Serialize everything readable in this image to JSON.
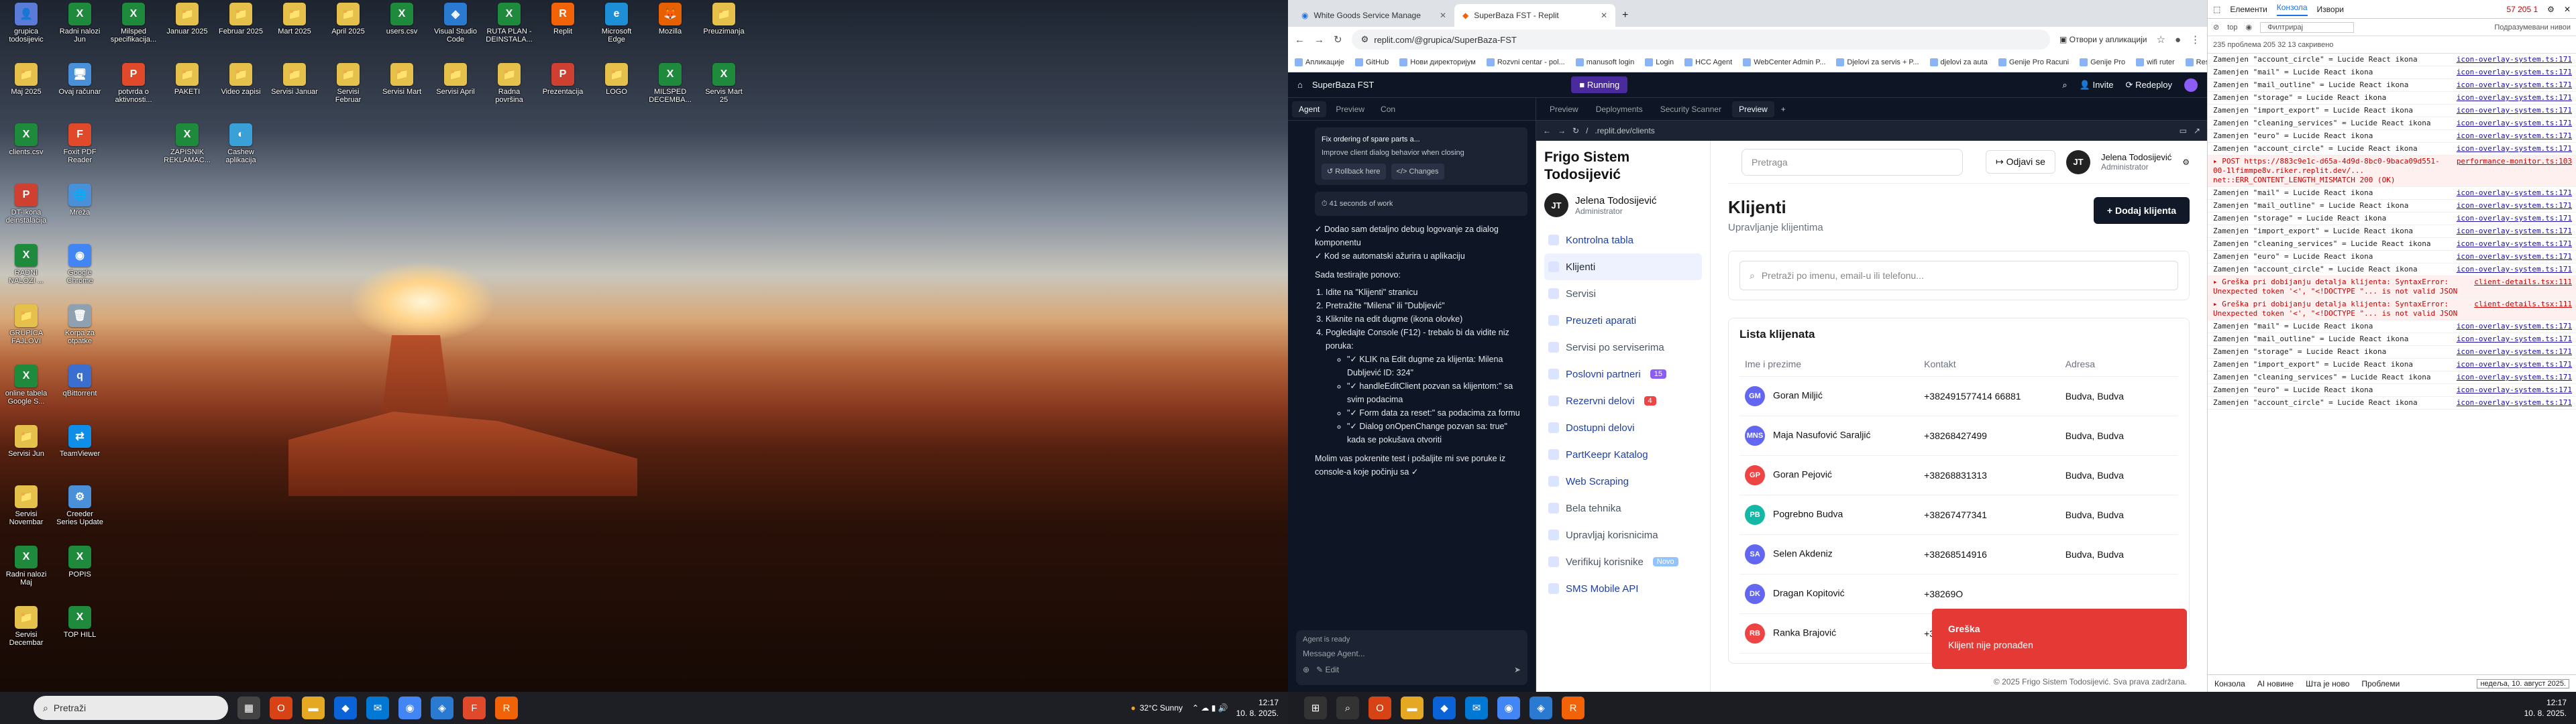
{
  "desktop": {
    "icons": [
      {
        "label": "grupica todosijevic",
        "color": "#5a7bd8",
        "glyph": "👤"
      },
      {
        "label": "Maj 2025",
        "color": "#e5c04a",
        "glyph": "📁"
      },
      {
        "label": "clients.csv",
        "color": "#1e8a3c",
        "glyph": "X"
      },
      {
        "label": "DT-Ikona deinstalacija",
        "color": "#d04030",
        "glyph": "P"
      },
      {
        "label": "RADNI NALOZI ...",
        "color": "#1e8a3c",
        "glyph": "X"
      },
      {
        "label": "GRUPICA FAJLOVI",
        "color": "#e5c04a",
        "glyph": "📁"
      },
      {
        "label": "online tabela Google S...",
        "color": "#1e8a3c",
        "glyph": "X"
      },
      {
        "label": "Servisi Jun",
        "color": "#e5c04a",
        "glyph": "📁"
      },
      {
        "label": "Servisi Novembar",
        "color": "#e5c04a",
        "glyph": "📁"
      },
      {
        "label": "Radni nalozi Maj",
        "color": "#1e8a3c",
        "glyph": "X"
      },
      {
        "label": "Servisi Decembar",
        "color": "#e5c04a",
        "glyph": "📁"
      },
      {
        "label": "Radni nalozi Jun",
        "color": "#1e8a3c",
        "glyph": "X"
      },
      {
        "label": "Ovaj računar",
        "color": "#4a90d9",
        "glyph": "🖥"
      },
      {
        "label": "Foxit PDF Reader",
        "color": "#e04a2a",
        "glyph": "F"
      },
      {
        "label": "Mreža",
        "color": "#4a90d9",
        "glyph": "🌐"
      },
      {
        "label": "Google Chrome",
        "color": "#4285f4",
        "glyph": "◉"
      },
      {
        "label": "Korpa za otpatke",
        "color": "#8fa0b0",
        "glyph": "🗑"
      },
      {
        "label": "qBittorrent",
        "color": "#3a6fd0",
        "glyph": "q"
      },
      {
        "label": "TeamViewer",
        "color": "#0e8ee9",
        "glyph": "⇄"
      },
      {
        "label": "Creeder Series Update",
        "color": "#4a90d9",
        "glyph": "⚙"
      },
      {
        "label": "POPIS",
        "color": "#1e8a3c",
        "glyph": "X"
      },
      {
        "label": "TOP HILL",
        "color": "#1e8a3c",
        "glyph": "X"
      },
      {
        "label": "Milsped specifikacija...",
        "color": "#1e8a3c",
        "glyph": "X"
      },
      {
        "label": "potvrda o aktivnosti...",
        "color": "#e04a2a",
        "glyph": "P"
      },
      {
        "label": "Januar 2025",
        "color": "#e5c04a",
        "glyph": "📁"
      },
      {
        "label": "Februar 2025",
        "color": "#e5c04a",
        "glyph": "📁"
      },
      {
        "label": "Mart 2025",
        "color": "#e5c04a",
        "glyph": "📁"
      },
      {
        "label": "April 2025",
        "color": "#e5c04a",
        "glyph": "📁"
      },
      {
        "label": "users.csv",
        "color": "#1e8a3c",
        "glyph": "X"
      },
      {
        "label": "Visual Studio Code",
        "color": "#2a7ad2",
        "glyph": "◈"
      },
      {
        "label": "RUTA PLAN - DEINSTALA...",
        "color": "#1e8a3c",
        "glyph": "X"
      },
      {
        "label": "Replit",
        "color": "#f26207",
        "glyph": "R"
      },
      {
        "label": "Microsoft Edge",
        "color": "#1d8fd6",
        "glyph": "e"
      },
      {
        "label": "Mozilla",
        "color": "#e66000",
        "glyph": "🦊"
      },
      {
        "label": "Preuzimanja",
        "color": "#e5c04a",
        "glyph": "📁"
      },
      {
        "label": "PAKETI",
        "color": "#e5c04a",
        "glyph": "📁"
      },
      {
        "label": "Video zapisi",
        "color": "#e5c04a",
        "glyph": "📁"
      },
      {
        "label": "Servisi Januar",
        "color": "#e5c04a",
        "glyph": "📁"
      },
      {
        "label": "Servisi Februar",
        "color": "#e5c04a",
        "glyph": "📁"
      },
      {
        "label": "Servisi Mart",
        "color": "#e5c04a",
        "glyph": "📁"
      },
      {
        "label": "Servisi April",
        "color": "#e5c04a",
        "glyph": "📁"
      },
      {
        "label": "Radna površina",
        "color": "#e5c04a",
        "glyph": "📁"
      },
      {
        "label": "Prezentacija",
        "color": "#d04030",
        "glyph": "P"
      },
      {
        "label": "LOGO",
        "color": "#e5c04a",
        "glyph": "📁"
      },
      {
        "label": "MILSPED DECEMBA...",
        "color": "#1e8a3c",
        "glyph": "X"
      },
      {
        "label": "Servis Mart 25",
        "color": "#1e8a3c",
        "glyph": "X"
      },
      {
        "label": "ZAPISNIK REKLAMAC...",
        "color": "#1e8a3c",
        "glyph": "X"
      },
      {
        "label": "Cashew aplikacija",
        "color": "#3aa0d8",
        "glyph": "◐"
      }
    ]
  },
  "taskbar_left": {
    "search_placeholder": "Pretraži",
    "weather": "32°C  Sunny",
    "time": "12:17",
    "date": "10. 8. 2025."
  },
  "browser": {
    "tabs": [
      {
        "label": "White Goods Service Manage"
      },
      {
        "label": "SuperBaza FST - Replit"
      }
    ],
    "url": "replit.com/@grupica/SuperBaza-FST",
    "open_in_app": "Отвори у апликацији",
    "bookmarks": [
      "Апликације",
      "GitHub",
      "Нови директоријум",
      "Rozvni centar - pol...",
      "manusoft login",
      "Login",
      "HCC Agent",
      "WebCenter Admin P...",
      "Djelovi za servis + P...",
      "djelovi za auta",
      "Genije Pro Racuni",
      "Genije Pro",
      "wifi ruter",
      "Resistor Calculator",
      "Сви обележивачи"
    ]
  },
  "replit": {
    "project": "SuperBaza FST",
    "run_label": "Running",
    "invite": "Invite",
    "redeploy": "Redeploy",
    "left_tabs": [
      "Agent",
      "Preview",
      "Con"
    ],
    "main_tabs": [
      "Preview",
      "Deployments",
      "Security Scanner",
      "Preview"
    ],
    "checkpoint": "Fix ordering of spare parts a...",
    "checkpoint_sub": "Improve client dialog behavior when closing",
    "rollback": "Rollback here",
    "changes": "Changes",
    "work_time": "41 seconds of work",
    "message_lines": [
      "✓ Dodao sam detaljno debug logovanje za dialog komponentu",
      "✓ Kod se automatski ažurira u aplikaciju",
      "Sada testirajte ponovo:"
    ],
    "steps": [
      "Idite na \"Klijenti\" stranicu",
      "Pretražite \"Milena\" ili \"Dubljević\"",
      "Kliknite na edit dugme (ikona olovke)",
      "Pogledajte Console (F12) - trebalo bi da vidite niz poruka:"
    ],
    "substeps": [
      "\"✓ KLIK na Edit dugme za klijenta: Milena Dubljević ID: 324\"",
      "\"✓ handleEditClient pozvan sa klijentom:\" sa svim podacima",
      "\"✓ Form data za reset:\" sa podacima za formu",
      "\"✓ Dialog onOpenChange pozvan sa: true\" kada se pokušava otvoriti"
    ],
    "closing": "Molim vas pokrenite test i pošaljite mi sve poruke iz console-a koje počinju sa ✓",
    "agent_status": "Agent is ready",
    "input_placeholder": "Message Agent...",
    "edit_label": "Edit",
    "preview_url": "/",
    "preview_url_domain": ".replit.dev/clients"
  },
  "app": {
    "brand": "Frigo Sistem Todosijević",
    "user_initials": "JT",
    "user_name": "Jelena Todosijević",
    "user_role": "Administrator",
    "nav": [
      {
        "label": "Kontrolna tabla",
        "state": "link"
      },
      {
        "label": "Klijenti",
        "state": "active"
      },
      {
        "label": "Servisi",
        "state": "muted",
        "badge": "",
        "badge_color": ""
      },
      {
        "label": "Preuzeti aparati",
        "state": "link"
      },
      {
        "label": "Servisi po serviserima",
        "state": "muted"
      },
      {
        "label": "Poslovni partneri",
        "state": "link",
        "badge": "15",
        "badge_color": "#8b5cf6"
      },
      {
        "label": "Rezervni delovi",
        "state": "link",
        "badge": "4",
        "badge_color": "#ef4444"
      },
      {
        "label": "Dostupni delovi",
        "state": "link"
      },
      {
        "label": "PartKeepr Katalog",
        "state": "link"
      },
      {
        "label": "Web Scraping",
        "state": "link"
      },
      {
        "label": "Bela tehnika",
        "state": "muted"
      },
      {
        "label": "Upravljaj korisnicima",
        "state": "muted"
      },
      {
        "label": "Verifikuj korisnike",
        "state": "muted",
        "badge": "Novo",
        "badge_color": "#93c5fd"
      },
      {
        "label": "SMS Mobile API",
        "state": "link"
      }
    ],
    "header_search": "Pretraga",
    "logout": "Odjavi se",
    "page_title": "Klijenti",
    "page_subtitle": "Upravljanje klijentima",
    "add_button": "Dodaj klijenta",
    "client_search": "Pretraži po imenu, email-u ili telefonu...",
    "list_title": "Lista klijenata",
    "columns": [
      "Ime i prezime",
      "Kontakt",
      "Adresa"
    ],
    "rows": [
      {
        "initials": "GM",
        "name": "Goran Miljić",
        "contact": "+382491577414 66881",
        "address": "Budva, Budva",
        "color": "#6366f1"
      },
      {
        "initials": "MNS",
        "name": "Maja Nasufović Saraljić",
        "contact": "+38268427499",
        "address": "Budva, Budva",
        "color": "#6366f1"
      },
      {
        "initials": "GP",
        "name": "Goran Pejović",
        "contact": "+38268831313",
        "address": "Budva, Budva",
        "color": "#ef4444"
      },
      {
        "initials": "PB",
        "name": "Pogrebno Budva",
        "contact": "+38267477341",
        "address": "Budva, Budva",
        "color": "#14b8a6"
      },
      {
        "initials": "SA",
        "name": "Selen Akdeniz",
        "contact": "+38268514916",
        "address": "Budva, Budva",
        "color": "#6366f1"
      },
      {
        "initials": "DK",
        "name": "Dragan Kopitović",
        "contact": "+38269O",
        "address": "",
        "color": "#6366f1"
      },
      {
        "initials": "RB",
        "name": "Ranka Brajović",
        "contact": "+38269337227",
        "address": "Petrovac, Petrovac",
        "color": "#ef4444"
      }
    ],
    "toast_title": "Greška",
    "toast_msg": "Klijent nije pronađen",
    "footer": "© 2025 Frigo Sistem Todosijević. Sva prava zadržana."
  },
  "devtools": {
    "tabs": [
      "Елементи",
      "Конзола",
      "Извори"
    ],
    "counts": "57  205  1",
    "filter": "Филтрирај",
    "levels": "Подразумевани нивои",
    "issues": "235 проблема  205  32  13 сакривено",
    "top": "top",
    "logs": [
      {
        "t": "Zamenjen \"account_circle\" = Lucide React ikona",
        "s": "icon-overlay-system.ts:171",
        "e": false
      },
      {
        "t": "Zamenjen \"mail\" = Lucide React ikona",
        "s": "icon-overlay-system.ts:171",
        "e": false
      },
      {
        "t": "Zamenjen \"mail_outline\" = Lucide React ikona",
        "s": "icon-overlay-system.ts:171",
        "e": false
      },
      {
        "t": "Zamenjen \"storage\" = Lucide React ikona",
        "s": "icon-overlay-system.ts:171",
        "e": false
      },
      {
        "t": "Zamenjen \"import_export\" = Lucide React ikona",
        "s": "icon-overlay-system.ts:171",
        "e": false
      },
      {
        "t": "Zamenjen \"cleaning_services\" = Lucide React ikona",
        "s": "icon-overlay-system.ts:171",
        "e": false
      },
      {
        "t": "Zamenjen \"euro\" = Lucide React ikona",
        "s": "icon-overlay-system.ts:171",
        "e": false
      },
      {
        "t": "Zamenjen \"account_circle\" = Lucide React ikona",
        "s": "icon-overlay-system.ts:171",
        "e": false
      },
      {
        "t": "▸ POST https://883c9e1c-d65a-4d9d-8bc0-9baca09d551-00-1lfimmpe8v.riker.replit.dev/... net::ERR_CONTENT_LENGTH_MISMATCH 200 (OK)",
        "s": "performance-monitor.ts:103",
        "e": true
      },
      {
        "t": "Zamenjen \"mail\" = Lucide React ikona",
        "s": "icon-overlay-system.ts:171",
        "e": false
      },
      {
        "t": "Zamenjen \"mail_outline\" = Lucide React ikona",
        "s": "icon-overlay-system.ts:171",
        "e": false
      },
      {
        "t": "Zamenjen \"storage\" = Lucide React ikona",
        "s": "icon-overlay-system.ts:171",
        "e": false
      },
      {
        "t": "Zamenjen \"import_export\" = Lucide React ikona",
        "s": "icon-overlay-system.ts:171",
        "e": false
      },
      {
        "t": "Zamenjen \"cleaning_services\" = Lucide React ikona",
        "s": "icon-overlay-system.ts:171",
        "e": false
      },
      {
        "t": "Zamenjen \"euro\" = Lucide React ikona",
        "s": "icon-overlay-system.ts:171",
        "e": false
      },
      {
        "t": "Zamenjen \"account_circle\" = Lucide React ikona",
        "s": "icon-overlay-system.ts:171",
        "e": false
      },
      {
        "t": "▸ Greška pri dobijanju detalja klijenta: SyntaxError: Unexpected token '<', \"<!DOCTYPE \"... is not valid JSON",
        "s": "client-details.tsx:111",
        "e": true
      },
      {
        "t": "▸ Greška pri dobijanju detalja klijenta: SyntaxError: Unexpected token '<', \"<!DOCTYPE \"... is not valid JSON",
        "s": "client-details.tsx:111",
        "e": true
      },
      {
        "t": "Zamenjen \"mail\" = Lucide React ikona",
        "s": "icon-overlay-system.ts:171",
        "e": false
      },
      {
        "t": "Zamenjen \"mail_outline\" = Lucide React ikona",
        "s": "icon-overlay-system.ts:171",
        "e": false
      },
      {
        "t": "Zamenjen \"storage\" = Lucide React ikona",
        "s": "icon-overlay-system.ts:171",
        "e": false
      },
      {
        "t": "Zamenjen \"import_export\" = Lucide React ikona",
        "s": "icon-overlay-system.ts:171",
        "e": false
      },
      {
        "t": "Zamenjen \"cleaning_services\" = Lucide React ikona",
        "s": "icon-overlay-system.ts:171",
        "e": false
      },
      {
        "t": "Zamenjen \"euro\" = Lucide React ikona",
        "s": "icon-overlay-system.ts:171",
        "e": false
      },
      {
        "t": "Zamenjen \"account_circle\" = Lucide React ikona",
        "s": "icon-overlay-system.ts:171",
        "e": false
      }
    ],
    "bottom_tabs": [
      "Конзола",
      "AI новине",
      "Шта је ново",
      "Проблеми"
    ],
    "bottom_right": "недеља, 10. ",
    "bottom_right2": "август 2025."
  },
  "taskbar_right": {
    "time": "12:17",
    "date": "10. 8. 2025."
  }
}
